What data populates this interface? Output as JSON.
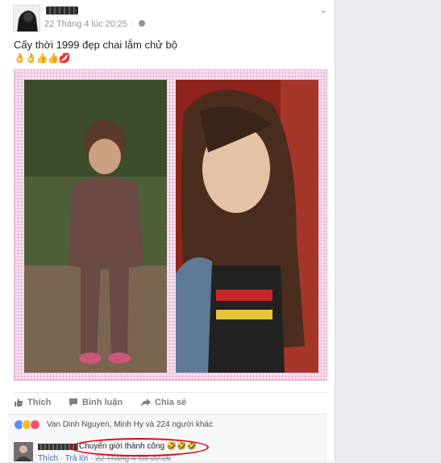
{
  "post": {
    "author_name": "●●●●●",
    "timestamp": "22 Tháng 4 lúc 20:25 ·",
    "privacy_icon": "globe-icon",
    "menu_icon": "chevron-down-icon",
    "text": "Cấy thời 1999 đẹp chai lắm chử bộ",
    "emojis": "👌👌👍👍💋"
  },
  "actions": {
    "like_label": "Thích",
    "comment_label": "Bình luận",
    "share_label": "Chia sẻ"
  },
  "reactions": {
    "summary": "Van Dinh Nguyen, Minh Hy và 224 người khác",
    "types": [
      "like",
      "haha",
      "love"
    ]
  },
  "comment": {
    "author_name": "●●●●●●",
    "text": "Chuyển giới thành công 🤣🤣🤣",
    "like_label": "Thích",
    "separator": "·",
    "reply_label": "Trả lời",
    "time": "22 Tháng 4 lúc 20:26"
  },
  "colors": {
    "facebook_blue": "#4267b2",
    "annotation_red": "#e8000a",
    "frame_pink": "#f7e3f0"
  }
}
